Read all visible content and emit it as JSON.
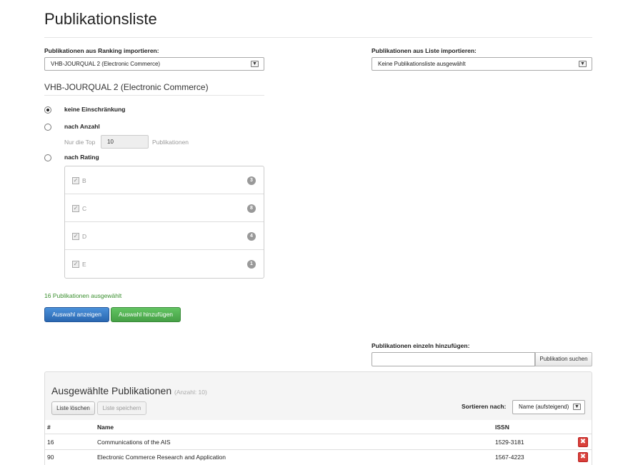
{
  "page": {
    "title": "Publikationsliste"
  },
  "import_ranking": {
    "label": "Publikationen aus Ranking importieren:",
    "selected": "VHB-JOURQUAL 2 (Electronic Commerce)"
  },
  "import_list": {
    "label": "Publikationen aus Liste importieren:",
    "selected": "Keine Publikationsliste ausgewählt"
  },
  "ranking_section": {
    "title": "VHB-JOURQUAL 2 (Electronic Commerce)",
    "options": [
      {
        "label": "keine Einschränkung",
        "checked": true
      },
      {
        "label": "nach Anzahl",
        "checked": false
      },
      {
        "label": "nach Rating",
        "checked": false
      }
    ],
    "top": {
      "prefix": "Nur die Top",
      "value": "10",
      "suffix": "Publikationen"
    },
    "ratings": [
      {
        "letter": "B",
        "count": "3",
        "checked": true
      },
      {
        "letter": "C",
        "count": "8",
        "checked": true
      },
      {
        "letter": "D",
        "count": "4",
        "checked": true
      },
      {
        "letter": "E",
        "count": "1",
        "checked": true
      }
    ],
    "selected_text": "16 Publikationen ausgewählt",
    "show_button": "Auswahl anzeigen",
    "add_button": "Auswahl hinzufügen"
  },
  "single_add": {
    "label": "Publikationen einzeln hinzufügen:",
    "input_value": "",
    "search_button": "Publikation suchen"
  },
  "selected_publications": {
    "title": "Ausgewählte Publikationen",
    "count_text": "(Anzahl: 10)",
    "clear_button": "Liste löschen",
    "save_button": "Liste speichern",
    "sort_label": "Sortieren nach:",
    "sort_value": "Name (aufsteigend)",
    "columns": [
      "#",
      "Name",
      "ISSN"
    ],
    "rows": [
      {
        "num": "16",
        "name": "Communications of the AIS",
        "issn": "1529-3181"
      },
      {
        "num": "90",
        "name": "Electronic Commerce Research and Application",
        "issn": "1567-4223"
      }
    ]
  },
  "colors": {
    "primary": "#2a67b1",
    "success": "#46a046",
    "danger": "#d9413b",
    "success_text": "#3a8f2e"
  }
}
